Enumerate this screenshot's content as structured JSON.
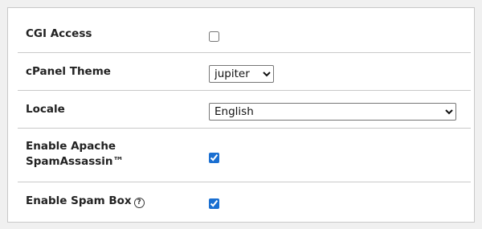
{
  "rows": [
    {
      "label": "CGI Access",
      "type": "checkbox",
      "checked": false
    },
    {
      "label": "cPanel Theme",
      "type": "select",
      "value": "jupiter"
    },
    {
      "label": "Locale",
      "type": "select",
      "value": "English"
    },
    {
      "label": "Enable Apache SpamAssassin™",
      "type": "checkbox",
      "checked": true
    },
    {
      "label": "Enable Spam Box",
      "type": "checkbox",
      "checked": true,
      "help": true
    }
  ],
  "help_glyph": "?",
  "accent_color": "#1a6fd1"
}
